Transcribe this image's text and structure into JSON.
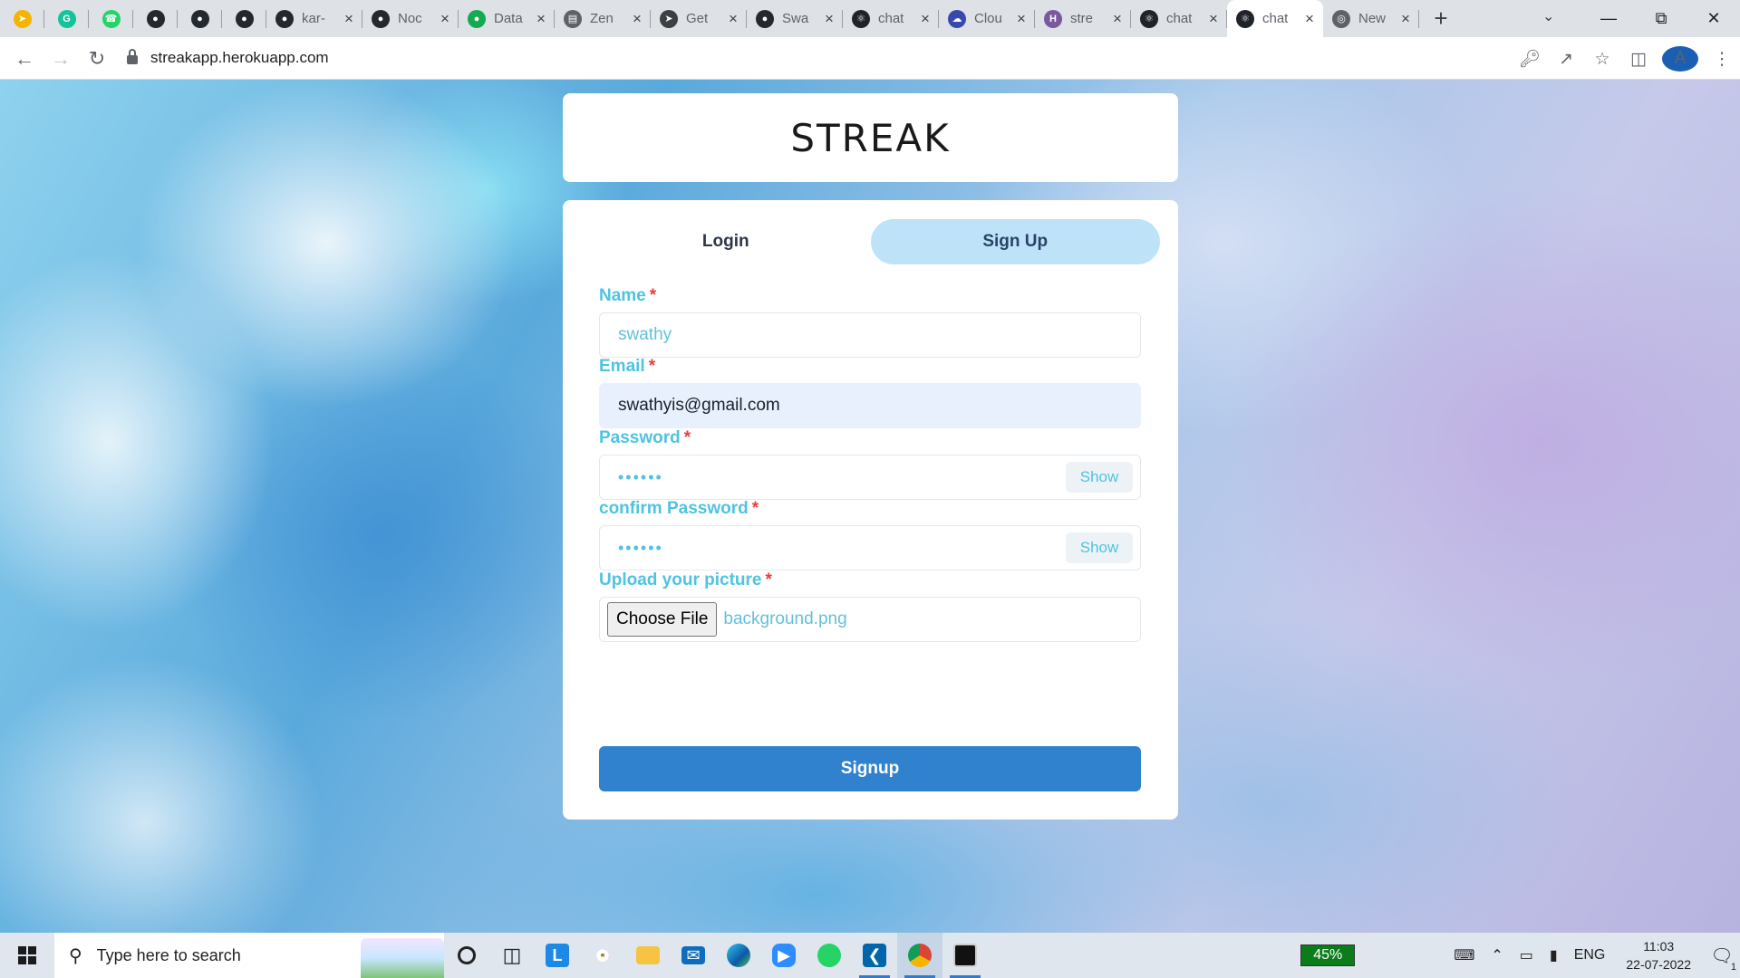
{
  "browser": {
    "tabs": [
      {
        "title": "",
        "icon": "compass-icon",
        "color": "#f4b400",
        "pinned": true
      },
      {
        "title": "",
        "icon": "grammarly-icon",
        "color": "#15c39a",
        "pinned": true
      },
      {
        "title": "",
        "icon": "whatsapp-icon",
        "color": "#25d366",
        "pinned": true
      },
      {
        "title": "",
        "icon": "github-icon",
        "color": "#24292f",
        "pinned": true
      },
      {
        "title": "",
        "icon": "github-icon",
        "color": "#24292f",
        "pinned": true
      },
      {
        "title": "",
        "icon": "github-icon",
        "color": "#24292f",
        "pinned": true
      },
      {
        "title": "kar-",
        "icon": "github-icon",
        "color": "#24292f"
      },
      {
        "title": "Noc",
        "icon": "github-icon",
        "color": "#24292f"
      },
      {
        "title": "Data",
        "icon": "mongodb-icon",
        "color": "#13aa52"
      },
      {
        "title": "Zen",
        "icon": "document-icon",
        "color": "#5f6368"
      },
      {
        "title": "Get",
        "icon": "compass-icon",
        "color": "#3c4043"
      },
      {
        "title": "Swa",
        "icon": "github-icon",
        "color": "#24292f"
      },
      {
        "title": "chat",
        "icon": "react-icon",
        "color": "#20232a"
      },
      {
        "title": "Clou",
        "icon": "cloud-icon",
        "color": "#3949ab"
      },
      {
        "title": "stre",
        "icon": "heroku-icon",
        "color": "#79589f"
      },
      {
        "title": "chat",
        "icon": "react-icon",
        "color": "#20232a"
      },
      {
        "title": "chat",
        "icon": "react-icon",
        "color": "#20232a",
        "active": true
      },
      {
        "title": "New",
        "icon": "globe-icon",
        "color": "#5f6368"
      }
    ],
    "new_tab_label": "+",
    "url": "streakapp.herokuapp.com"
  },
  "page": {
    "brand": "STREAK",
    "tabs": [
      {
        "label": "Login",
        "selected": false
      },
      {
        "label": "Sign Up",
        "selected": true
      }
    ],
    "fields": {
      "name": {
        "label": "Name",
        "required": "*",
        "value": "swathy"
      },
      "email": {
        "label": "Email",
        "required": "*",
        "value": "swathyis@gmail.com"
      },
      "password": {
        "label": "Password",
        "required": "*",
        "value": "••••••",
        "toggle": "Show"
      },
      "confirm": {
        "label": "confirm Password",
        "required": "*",
        "value": "••••••",
        "toggle": "Show"
      },
      "picture": {
        "label": "Upload your picture",
        "required": "*",
        "button": "Choose File",
        "file": "background.png"
      }
    },
    "submit_label": "Signup"
  },
  "taskbar": {
    "search_placeholder": "Type here to search",
    "battery": "45%",
    "language": "ENG",
    "time": "11:03",
    "date": "22-07-2022",
    "notifications": "1"
  }
}
